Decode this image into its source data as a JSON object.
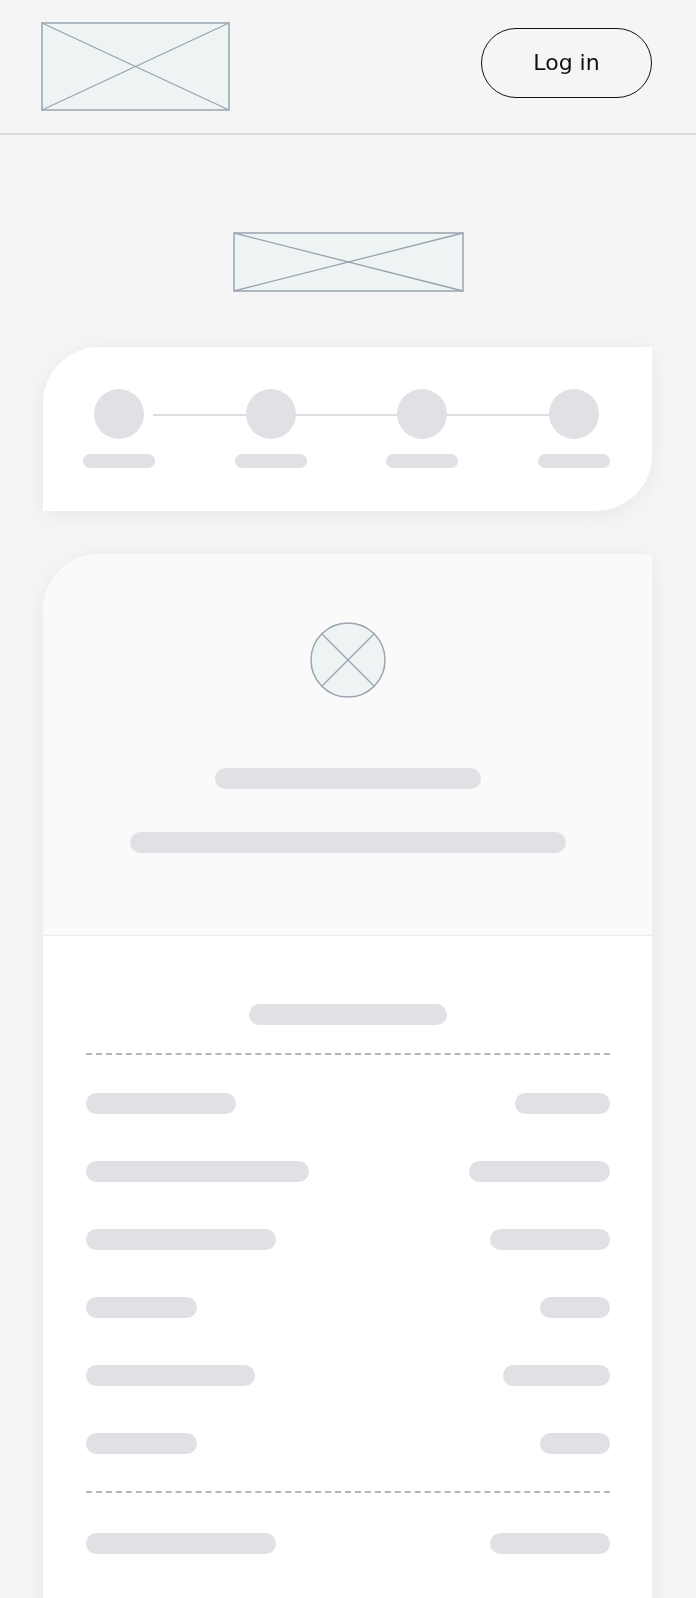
{
  "header": {
    "login_button": "Log in"
  }
}
